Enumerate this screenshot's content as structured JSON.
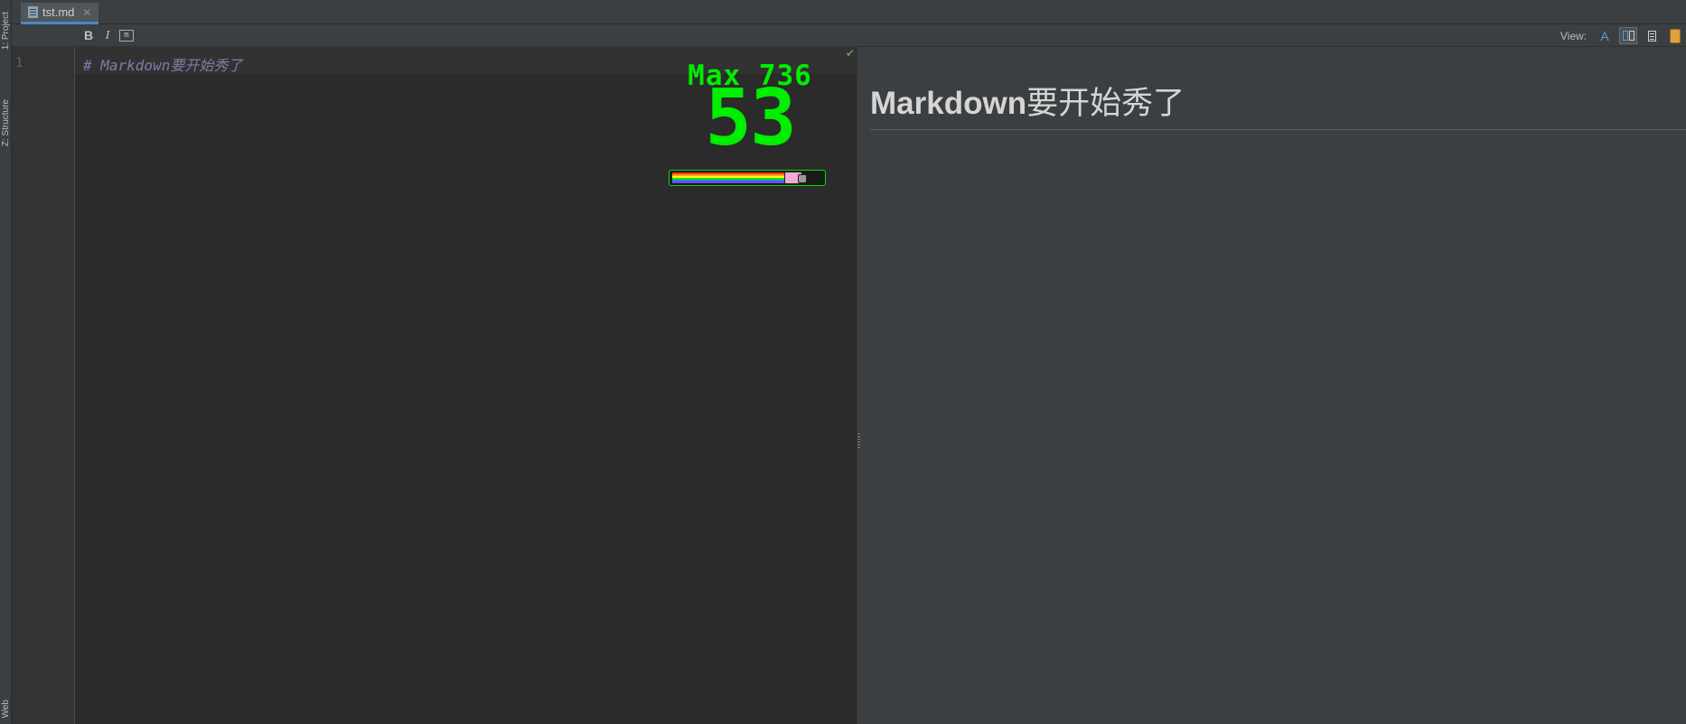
{
  "side_tabs": {
    "project": "1: Project",
    "structure": "Z: Structure",
    "web": "Web"
  },
  "tabs": [
    {
      "label": "tst.md",
      "active": true
    }
  ],
  "toolbar": {
    "bold_label": "B",
    "italic_label": "I",
    "code_label": "m",
    "view_label": "View:",
    "view_editor_label": "A"
  },
  "editor": {
    "line_number": "1",
    "line_text": "# Markdown要开始秀了"
  },
  "combo": {
    "max_label": "Max 736",
    "count": "53",
    "progress": 0.85
  },
  "preview": {
    "heading_latin": "Markdown",
    "heading_cjk": "要开始秀了"
  },
  "colors": {
    "accent": "#4a88c7",
    "combo": "#00ee00",
    "editor_bg": "#2b2b2b",
    "preview_bg": "#3c3f41"
  }
}
